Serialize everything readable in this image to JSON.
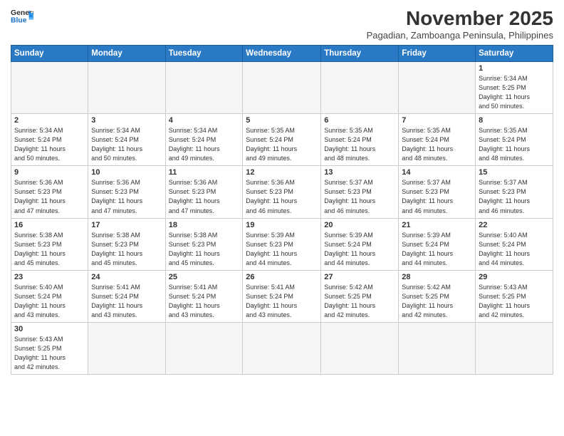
{
  "header": {
    "logo_general": "General",
    "logo_blue": "Blue",
    "month_title": "November 2025",
    "location": "Pagadian, Zamboanga Peninsula, Philippines"
  },
  "weekdays": [
    "Sunday",
    "Monday",
    "Tuesday",
    "Wednesday",
    "Thursday",
    "Friday",
    "Saturday"
  ],
  "weeks": [
    [
      {
        "day": "",
        "info": ""
      },
      {
        "day": "",
        "info": ""
      },
      {
        "day": "",
        "info": ""
      },
      {
        "day": "",
        "info": ""
      },
      {
        "day": "",
        "info": ""
      },
      {
        "day": "",
        "info": ""
      },
      {
        "day": "1",
        "info": "Sunrise: 5:34 AM\nSunset: 5:25 PM\nDaylight: 11 hours\nand 50 minutes."
      }
    ],
    [
      {
        "day": "2",
        "info": "Sunrise: 5:34 AM\nSunset: 5:24 PM\nDaylight: 11 hours\nand 50 minutes."
      },
      {
        "day": "3",
        "info": "Sunrise: 5:34 AM\nSunset: 5:24 PM\nDaylight: 11 hours\nand 50 minutes."
      },
      {
        "day": "4",
        "info": "Sunrise: 5:34 AM\nSunset: 5:24 PM\nDaylight: 11 hours\nand 49 minutes."
      },
      {
        "day": "5",
        "info": "Sunrise: 5:35 AM\nSunset: 5:24 PM\nDaylight: 11 hours\nand 49 minutes."
      },
      {
        "day": "6",
        "info": "Sunrise: 5:35 AM\nSunset: 5:24 PM\nDaylight: 11 hours\nand 48 minutes."
      },
      {
        "day": "7",
        "info": "Sunrise: 5:35 AM\nSunset: 5:24 PM\nDaylight: 11 hours\nand 48 minutes."
      },
      {
        "day": "8",
        "info": "Sunrise: 5:35 AM\nSunset: 5:24 PM\nDaylight: 11 hours\nand 48 minutes."
      }
    ],
    [
      {
        "day": "9",
        "info": "Sunrise: 5:36 AM\nSunset: 5:23 PM\nDaylight: 11 hours\nand 47 minutes."
      },
      {
        "day": "10",
        "info": "Sunrise: 5:36 AM\nSunset: 5:23 PM\nDaylight: 11 hours\nand 47 minutes."
      },
      {
        "day": "11",
        "info": "Sunrise: 5:36 AM\nSunset: 5:23 PM\nDaylight: 11 hours\nand 47 minutes."
      },
      {
        "day": "12",
        "info": "Sunrise: 5:36 AM\nSunset: 5:23 PM\nDaylight: 11 hours\nand 46 minutes."
      },
      {
        "day": "13",
        "info": "Sunrise: 5:37 AM\nSunset: 5:23 PM\nDaylight: 11 hours\nand 46 minutes."
      },
      {
        "day": "14",
        "info": "Sunrise: 5:37 AM\nSunset: 5:23 PM\nDaylight: 11 hours\nand 46 minutes."
      },
      {
        "day": "15",
        "info": "Sunrise: 5:37 AM\nSunset: 5:23 PM\nDaylight: 11 hours\nand 46 minutes."
      }
    ],
    [
      {
        "day": "16",
        "info": "Sunrise: 5:38 AM\nSunset: 5:23 PM\nDaylight: 11 hours\nand 45 minutes."
      },
      {
        "day": "17",
        "info": "Sunrise: 5:38 AM\nSunset: 5:23 PM\nDaylight: 11 hours\nand 45 minutes."
      },
      {
        "day": "18",
        "info": "Sunrise: 5:38 AM\nSunset: 5:23 PM\nDaylight: 11 hours\nand 45 minutes."
      },
      {
        "day": "19",
        "info": "Sunrise: 5:39 AM\nSunset: 5:23 PM\nDaylight: 11 hours\nand 44 minutes."
      },
      {
        "day": "20",
        "info": "Sunrise: 5:39 AM\nSunset: 5:24 PM\nDaylight: 11 hours\nand 44 minutes."
      },
      {
        "day": "21",
        "info": "Sunrise: 5:39 AM\nSunset: 5:24 PM\nDaylight: 11 hours\nand 44 minutes."
      },
      {
        "day": "22",
        "info": "Sunrise: 5:40 AM\nSunset: 5:24 PM\nDaylight: 11 hours\nand 44 minutes."
      }
    ],
    [
      {
        "day": "23",
        "info": "Sunrise: 5:40 AM\nSunset: 5:24 PM\nDaylight: 11 hours\nand 43 minutes."
      },
      {
        "day": "24",
        "info": "Sunrise: 5:41 AM\nSunset: 5:24 PM\nDaylight: 11 hours\nand 43 minutes."
      },
      {
        "day": "25",
        "info": "Sunrise: 5:41 AM\nSunset: 5:24 PM\nDaylight: 11 hours\nand 43 minutes."
      },
      {
        "day": "26",
        "info": "Sunrise: 5:41 AM\nSunset: 5:24 PM\nDaylight: 11 hours\nand 43 minutes."
      },
      {
        "day": "27",
        "info": "Sunrise: 5:42 AM\nSunset: 5:25 PM\nDaylight: 11 hours\nand 42 minutes."
      },
      {
        "day": "28",
        "info": "Sunrise: 5:42 AM\nSunset: 5:25 PM\nDaylight: 11 hours\nand 42 minutes."
      },
      {
        "day": "29",
        "info": "Sunrise: 5:43 AM\nSunset: 5:25 PM\nDaylight: 11 hours\nand 42 minutes."
      }
    ],
    [
      {
        "day": "30",
        "info": "Sunrise: 5:43 AM\nSunset: 5:25 PM\nDaylight: 11 hours\nand 42 minutes."
      },
      {
        "day": "",
        "info": ""
      },
      {
        "day": "",
        "info": ""
      },
      {
        "day": "",
        "info": ""
      },
      {
        "day": "",
        "info": ""
      },
      {
        "day": "",
        "info": ""
      },
      {
        "day": "",
        "info": ""
      }
    ]
  ]
}
